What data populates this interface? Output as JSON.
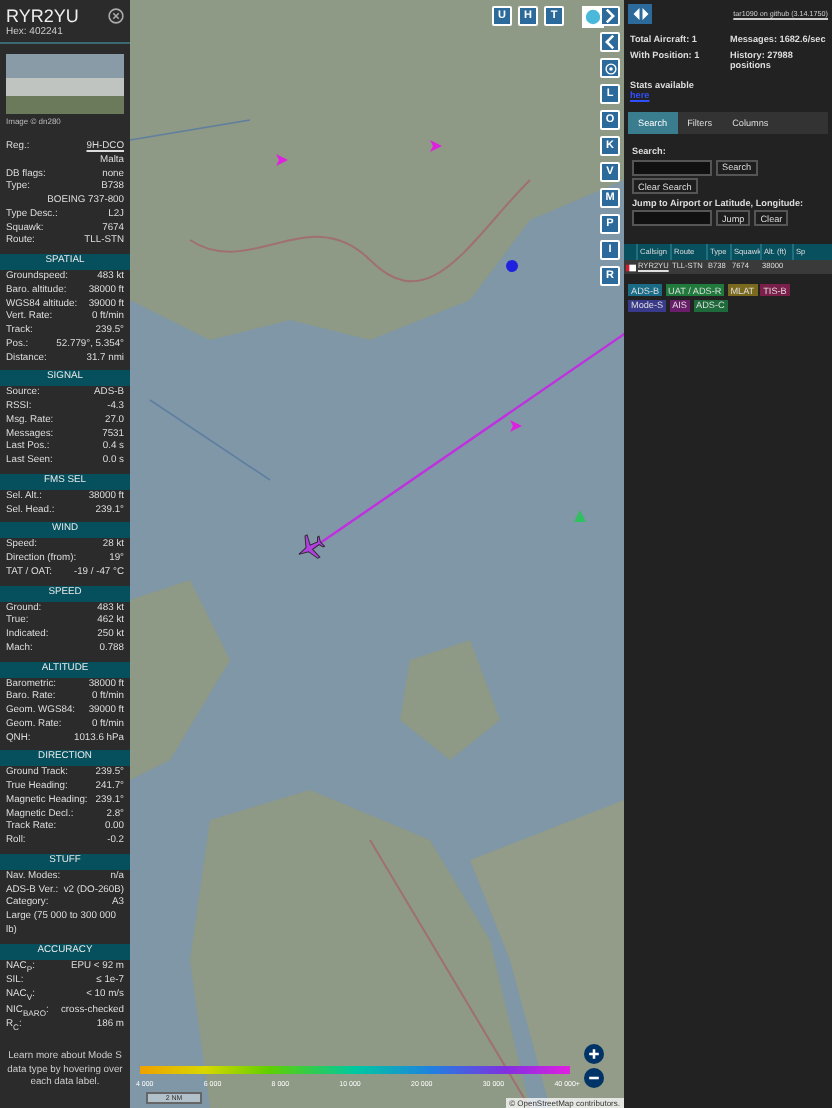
{
  "aircraft": {
    "callsign": "RYR2YU",
    "hex": "Hex: 402241",
    "photo_credit": "Image © dn280"
  },
  "info_rows": [
    {
      "kind": "pair",
      "label": "Reg.:",
      "value": "9H-DCO",
      "link": true
    },
    {
      "kind": "value_only",
      "value": "Malta"
    },
    {
      "kind": "pair",
      "label": "DB flags:",
      "value": "none",
      "link": false
    },
    {
      "kind": "pair",
      "label": "Type:",
      "value": "B738",
      "link": false
    },
    {
      "kind": "value_only",
      "value": "BOEING 737-800"
    },
    {
      "kind": "pair",
      "label": "Type Desc.:",
      "value": "L2J",
      "link": false
    },
    {
      "kind": "pair",
      "label": "Squawk:",
      "value": "7674",
      "link": false
    },
    {
      "kind": "pair",
      "label": "Route:",
      "value": "TLL-STN",
      "link": false
    }
  ],
  "sections": [
    {
      "title": "SPATIAL",
      "rows": [
        {
          "kind": "pair",
          "label": "Groundspeed:",
          "value": "483 kt"
        },
        {
          "kind": "pair",
          "label": "Baro. altitude:",
          "value": "38000 ft"
        },
        {
          "kind": "pair",
          "label": "WGS84 altitude:",
          "value": "39000 ft"
        },
        {
          "kind": "pair",
          "label": "Vert. Rate:",
          "value": "0 ft/min"
        },
        {
          "kind": "pair",
          "label": "Track:",
          "value": "239.5°"
        },
        {
          "kind": "pair",
          "label": "Pos.:",
          "value": "52.779°, 5.354°"
        },
        {
          "kind": "pair",
          "label": "Distance:",
          "value": "31.7 nmi"
        }
      ]
    },
    {
      "title": "SIGNAL",
      "rows": [
        {
          "kind": "pair",
          "label": "Source:",
          "value": "ADS-B"
        },
        {
          "kind": "pair",
          "label": "RSSI:",
          "value": "-4.3"
        },
        {
          "kind": "pair",
          "label": "Msg. Rate:",
          "value": "27.0"
        },
        {
          "kind": "pair",
          "label": "Messages:",
          "value": "7531"
        },
        {
          "kind": "pair",
          "label": "Last Pos.:",
          "value": "0.4 s"
        },
        {
          "kind": "pair",
          "label": "Last Seen:",
          "value": "0.0 s"
        }
      ]
    },
    {
      "title": "FMS SEL",
      "rows": [
        {
          "kind": "pair",
          "label": "Sel. Alt.:",
          "value": "38000 ft"
        },
        {
          "kind": "pair",
          "label": "Sel. Head.:",
          "value": "239.1°"
        }
      ]
    },
    {
      "title": "WIND",
      "rows": [
        {
          "kind": "pair",
          "label": "Speed:",
          "value": "28 kt"
        },
        {
          "kind": "pair",
          "label": "Direction (from):",
          "value": "19°"
        },
        {
          "kind": "pair",
          "label": "TAT / OAT:",
          "value": "-19 / -47 °C"
        }
      ]
    },
    {
      "title": "SPEED",
      "rows": [
        {
          "kind": "pair",
          "label": "Ground:",
          "value": "483 kt"
        },
        {
          "kind": "pair",
          "label": "True:",
          "value": "462 kt"
        },
        {
          "kind": "pair",
          "label": "Indicated:",
          "value": "250 kt"
        },
        {
          "kind": "pair",
          "label": "Mach:",
          "value": "0.788"
        }
      ]
    },
    {
      "title": "ALTITUDE",
      "rows": [
        {
          "kind": "pair",
          "label": "Barometric:",
          "value": "38000 ft"
        },
        {
          "kind": "pair",
          "label": "Baro. Rate:",
          "value": "0 ft/min"
        },
        {
          "kind": "pair",
          "label": "Geom. WGS84:",
          "value": "39000 ft"
        },
        {
          "kind": "pair",
          "label": "Geom. Rate:",
          "value": "0 ft/min"
        },
        {
          "kind": "pair",
          "label": "QNH:",
          "value": "1013.6 hPa"
        }
      ]
    },
    {
      "title": "DIRECTION",
      "rows": [
        {
          "kind": "pair",
          "label": "Ground Track:",
          "value": "239.5°"
        },
        {
          "kind": "pair",
          "label": "True Heading:",
          "value": "241.7°"
        },
        {
          "kind": "pair",
          "label": "Magnetic Heading:",
          "value": "239.1°"
        },
        {
          "kind": "pair",
          "label": "Magnetic Decl.:",
          "value": "2.8°"
        },
        {
          "kind": "pair",
          "label": "Track Rate:",
          "value": "0.00"
        },
        {
          "kind": "pair",
          "label": "Roll:",
          "value": "-0.2"
        }
      ]
    },
    {
      "title": "STUFF",
      "rows": [
        {
          "kind": "pair",
          "label": "Nav. Modes:",
          "value": "n/a"
        },
        {
          "kind": "pair",
          "label": "ADS-B Ver.:",
          "value": "v2 (DO-260B)"
        },
        {
          "kind": "pair",
          "label": "Category:",
          "value": "A3"
        },
        {
          "kind": "full",
          "value": "Large (75 000 to 300 000 lb)"
        }
      ]
    },
    {
      "title": "ACCURACY",
      "rows": [
        {
          "kind": "pair",
          "label": "NAC$_{P}$:",
          "value": "EPU < 92 m"
        },
        {
          "kind": "pair",
          "label": "SIL:",
          "value": "≤ 1e-7"
        },
        {
          "kind": "pair",
          "label": "NAC$_{V}$:",
          "value": "< 10 m/s"
        },
        {
          "kind": "pair",
          "label": "NIC$_{BARO}$:",
          "value": "cross-checked"
        },
        {
          "kind": "pair",
          "label": "R$_{C}$:",
          "value": "186 m"
        }
      ]
    }
  ],
  "footer_note": "Learn more about Mode S data type by hovering over each data label.",
  "map": {
    "top_buttons": [
      "U",
      "H",
      "T"
    ],
    "side_buttons": [
      "L",
      "O",
      "K",
      "V",
      "M",
      "P",
      "I",
      "R"
    ],
    "legend_ticks": [
      "4 000",
      "6 000",
      "8 000",
      "10 000",
      "20 000",
      "30 000",
      "40 000+"
    ],
    "scale": "2 NM",
    "attribution": "© OpenStreetMap contributors."
  },
  "right_panel": {
    "version_link": "tar1090 on github (3.14.1750)",
    "total_aircraft": "Total Aircraft: 1",
    "messages": "Messages: 1682.6/sec",
    "with_position": "With Position: 1",
    "history": "History: 27988 positions",
    "stats_text": "Stats available",
    "stats_link": "here",
    "tabs": [
      {
        "label": "Search",
        "selected": true
      },
      {
        "label": "Filters",
        "selected": false
      },
      {
        "label": "Columns",
        "selected": false
      }
    ],
    "search_label": "Search:",
    "search_button": "Search",
    "clear_search_button": "Clear Search",
    "jump_label": "Jump to Airport or Latitude, Longitude:",
    "jump_button": "Jump",
    "clear_button": "Clear",
    "table": {
      "columns": [
        "Callsign",
        "Route",
        "Type",
        "Squawk",
        "Alt. (ft)",
        "Sp"
      ],
      "rows": [
        {
          "cells": [
            "RYR2YU",
            "TLL-STN",
            "B738",
            "7674",
            "38000"
          ],
          "selected": true
        }
      ]
    },
    "legend": [
      {
        "label": "ADS-B",
        "color": "#1a6b86"
      },
      {
        "label": "UAT / ADS-R",
        "color": "#1f7a3c"
      },
      {
        "label": "MLAT",
        "color": "#7a6a1e"
      },
      {
        "label": "TIS-B",
        "color": "#7a1e4a"
      },
      {
        "label": "Mode-S",
        "color": "#3a3a8a"
      },
      {
        "label": "AIS",
        "color": "#6a1e6a"
      },
      {
        "label": "ADS-C",
        "color": "#1e6a3a"
      }
    ]
  }
}
